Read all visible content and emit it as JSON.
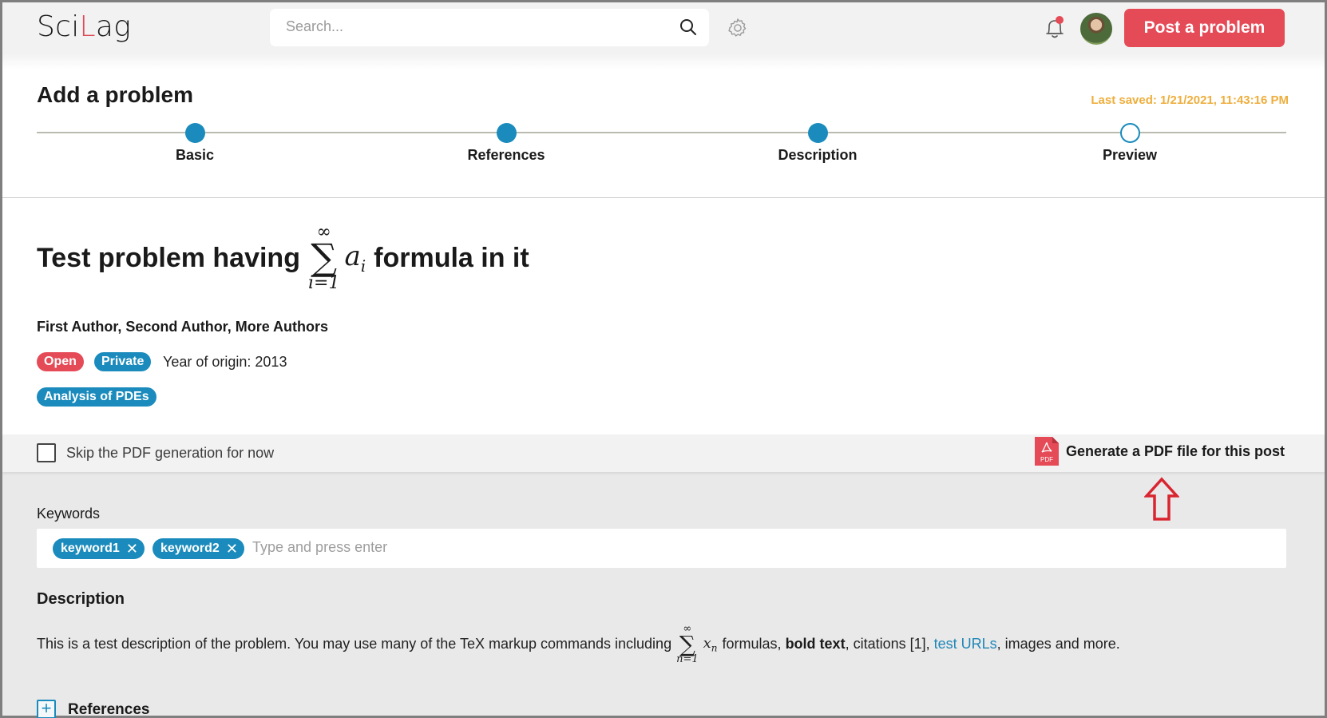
{
  "header": {
    "logo_prefix": "Sci",
    "logo_accent": "L",
    "logo_suffix": "ag",
    "search_placeholder": "Search...",
    "search_icon": "search-icon",
    "settings_icon": "gear-icon",
    "notifications_icon": "bell-icon",
    "notification_dot": true,
    "avatar": "user-avatar",
    "post_button": "Post a problem"
  },
  "page": {
    "title": "Add a problem",
    "last_saved": "Last saved: 1/21/2021, 11:43:16 PM"
  },
  "stepper": {
    "steps": [
      {
        "label": "Basic",
        "state": "completed"
      },
      {
        "label": "References",
        "state": "completed"
      },
      {
        "label": "Description",
        "state": "completed"
      },
      {
        "label": "Preview",
        "state": "current"
      }
    ]
  },
  "problem": {
    "title_before": "Test problem having",
    "title_math": {
      "op": "∑",
      "upper": "∞",
      "lower": "i=1",
      "var": "a",
      "sub": "i"
    },
    "title_after": "formula in it",
    "authors": [
      "First Author,",
      "Second Author,",
      "More Authors"
    ],
    "status_badge": "Open",
    "visibility_badge": "Private",
    "year_of_origin": "Year of origin: 2013",
    "subject_tag": "Analysis of PDEs"
  },
  "pdf_bar": {
    "skip_label": "Skip the PDF generation for now",
    "skip_checked": false,
    "generate_label": "Generate a PDF file for this post",
    "pdf_icon_text": "PDF"
  },
  "keywords": {
    "label": "Keywords",
    "chips": [
      "keyword1",
      "keyword2"
    ],
    "remove_glyph": "✕",
    "placeholder": "Type and press enter"
  },
  "description": {
    "label": "Description",
    "text_before": "This is a test description of the problem. You may use many of the TeX markup commands including",
    "math": {
      "op": "∑",
      "upper": "∞",
      "lower": "n=1",
      "var": "x",
      "sub": "n"
    },
    "text_mid1": "formulas,",
    "bold_text": "bold text",
    "text_mid2": ", citations [1],",
    "link_text": "test URLs",
    "text_after": ", images and more."
  },
  "references": {
    "toggle_glyph": "+",
    "label": "References"
  },
  "annotations": {
    "arrow_color": "#d9252f"
  },
  "colors": {
    "accent_red": "#e54a57",
    "accent_blue": "#1a8bbc",
    "saved_orange": "#eeae3c"
  }
}
